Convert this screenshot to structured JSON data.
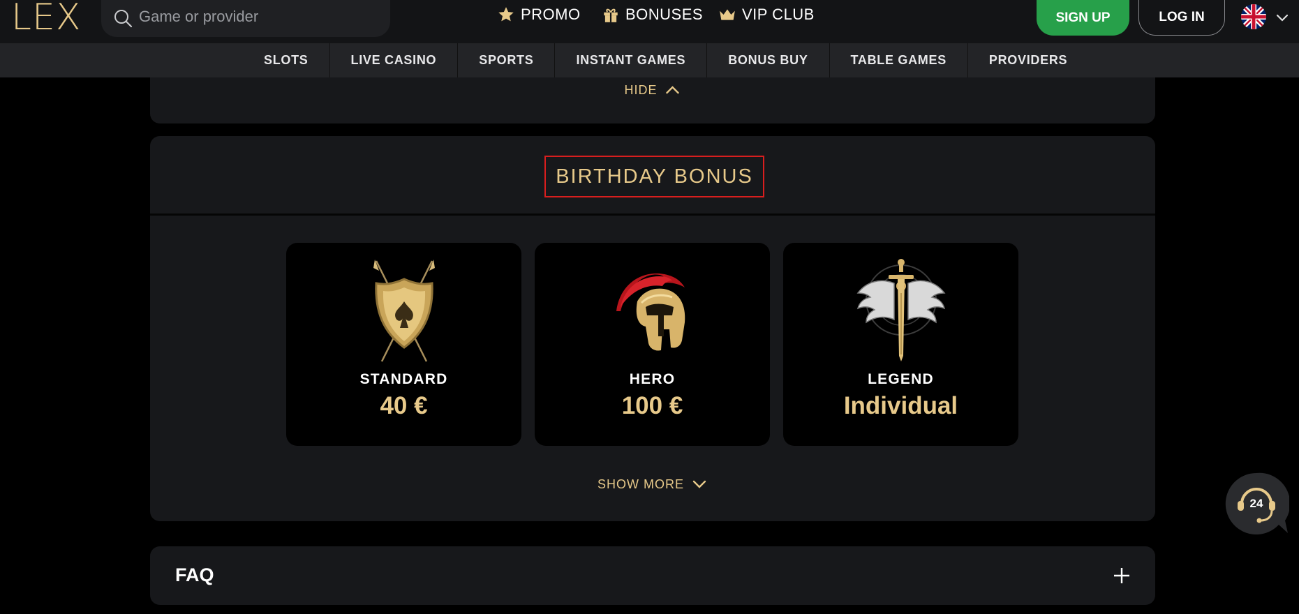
{
  "brand": {
    "logo_text": "LEX",
    "gold": "#e7c98a"
  },
  "search": {
    "placeholder": "Game or provider",
    "icon": "search-icon"
  },
  "top_nav": [
    {
      "label": "PROMO",
      "icon": "star-icon"
    },
    {
      "label": "BONUSES",
      "icon": "gift-icon"
    },
    {
      "label": "VIP CLUB",
      "icon": "crown-icon"
    }
  ],
  "auth": {
    "signup_label": "SIGN UP",
    "login_label": "LOG IN",
    "signup_color": "#27a04a"
  },
  "language": {
    "flag": "uk-flag-icon"
  },
  "categories": [
    "SLOTS",
    "LIVE CASINO",
    "SPORTS",
    "INSTANT GAMES",
    "BONUS BUY",
    "TABLE GAMES",
    "PROVIDERS"
  ],
  "collapse": {
    "hide_label": "HIDE"
  },
  "birthday": {
    "title": "BIRTHDAY BONUS",
    "highlight_color": "#d81e1e",
    "tiers": [
      {
        "name": "STANDARD",
        "amount": "40 €",
        "image": "shield-icon"
      },
      {
        "name": "HERO",
        "amount": "100 €",
        "image": "spartan-helmet-icon"
      },
      {
        "name": "LEGEND",
        "amount": "Individual",
        "image": "winged-sword-icon"
      }
    ],
    "show_more_label": "SHOW MORE"
  },
  "faq": {
    "title": "FAQ"
  },
  "support": {
    "badge": "24",
    "icon": "support-headset-icon"
  }
}
